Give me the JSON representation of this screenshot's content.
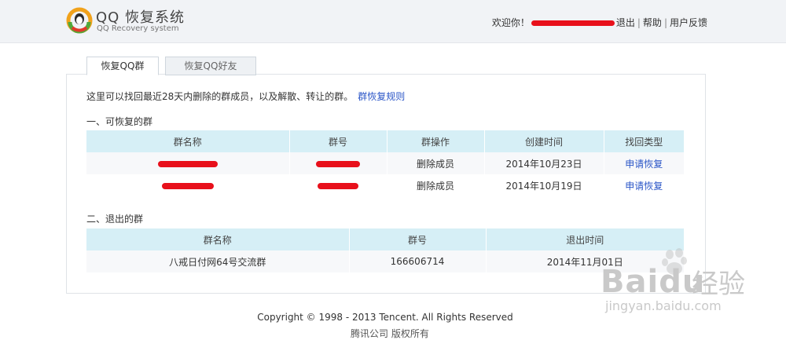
{
  "header": {
    "title": "QQ 恢复系统",
    "subtitle": "QQ Recovery system",
    "welcome": "欢迎你！",
    "logout": "退出",
    "help": "帮助",
    "feedback": "用户反馈",
    "separator": "|"
  },
  "tabs": [
    {
      "label": "恢复QQ群",
      "active": true
    },
    {
      "label": "恢复QQ好友",
      "active": false
    }
  ],
  "intro": {
    "text": "这里可以找回最近28天内删除的群成员，以及解散、转让的群。",
    "link": "群恢复规则"
  },
  "recoverable": {
    "title": "一、可恢复的群",
    "columns": [
      "群名称",
      "群号",
      "群操作",
      "创建时间",
      "找回类型"
    ],
    "rows": [
      {
        "operation": "删除成员",
        "created": "2014年10月23日",
        "action": "申请恢复"
      },
      {
        "operation": "删除成员",
        "created": "2014年10月19日",
        "action": "申请恢复"
      }
    ]
  },
  "exited": {
    "title": "二、退出的群",
    "columns": [
      "群名称",
      "群号",
      "退出时间"
    ],
    "rows": [
      {
        "name": "八戒日付网64号交流群",
        "number": "166606714",
        "time": "2014年11月01日"
      }
    ]
  },
  "footer": {
    "copyright": "Copyright © 1998 - 2013 Tencent. All Rights Reserved",
    "partial": "腾讯公司 版权所有"
  },
  "watermark": {
    "brand": "Bai",
    "brand_end": "du",
    "cn": "经验",
    "url": "jingyan.baidu.com"
  }
}
